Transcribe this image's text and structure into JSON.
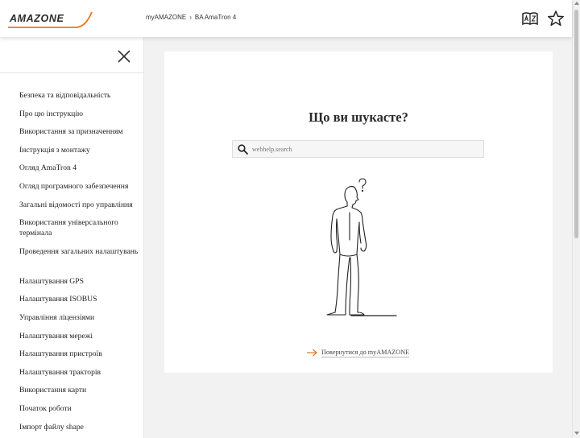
{
  "header": {
    "logo_text": "AMAZONE",
    "breadcrumb": [
      "myAMAZONE",
      "BA AmaTron 4"
    ],
    "breadcrumb_separator": "›",
    "icons": [
      "az-dictionary-icon",
      "star-icon"
    ]
  },
  "sidebar": {
    "close_icon": "close-icon",
    "items": [
      "Безпека та відповідальність",
      "Про цю інструкцію",
      "Використання за призначенням",
      "Інструкція з монтажу",
      "Огляд AmaTron 4",
      "Огляд програмного забезпечення",
      "Загальні відомості про управління",
      "Використання універсального термінала",
      "Проведення загальних налаштувань",
      "Налаштування GPS",
      "Налаштування ISOBUS",
      "Управління ліцензіями",
      "Налаштування мережі",
      "Налаштування пристроїв",
      "Налаштування тракторів",
      "Використання карти",
      "Початок роботи",
      "Імпорт файлу shape"
    ]
  },
  "main": {
    "title": "Що ви шукасте?",
    "search": {
      "placeholder": "webhelp.search",
      "value": ""
    },
    "back_link": "Повернутися до myAMAZONE"
  },
  "colors": {
    "accent": "#e87722",
    "text": "#222222",
    "background": "#f2f2f2"
  }
}
